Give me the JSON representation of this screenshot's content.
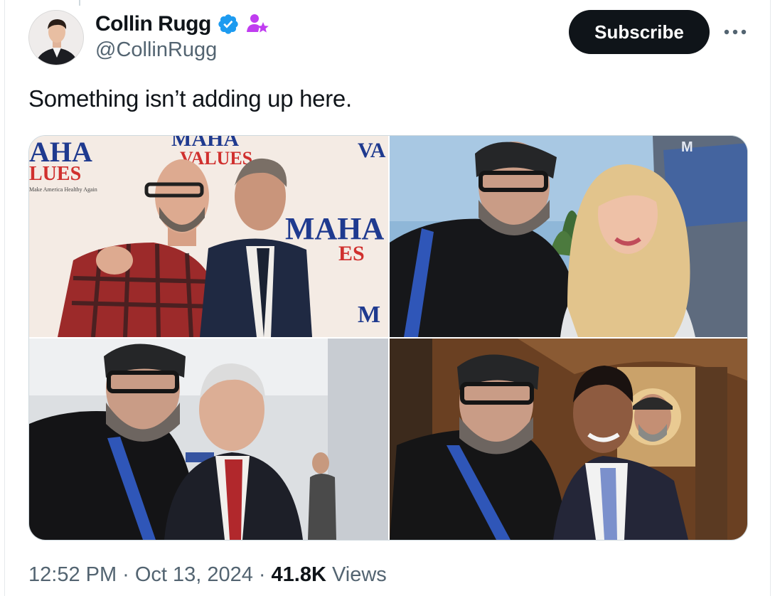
{
  "author": {
    "display_name": "Collin Rugg",
    "handle": "@CollinRugg",
    "verified_icon": "verified-badge-icon",
    "affiliation_icon": "subscriber-star-icon"
  },
  "actions": {
    "subscribe_label": "Subscribe",
    "more_icon": "more-horizontal-icon"
  },
  "tweet": {
    "text": "Something isn’t adding up here."
  },
  "media": {
    "photos": [
      {
        "name": "photo-maha-event",
        "backdrop_text": [
          "AHA",
          "LUES",
          "Make America Healthy Again",
          "MAHA",
          "VALUES",
          "MAHA",
          "ES",
          "VA",
          "M"
        ]
      },
      {
        "name": "photo-selfie-blonde-woman",
        "backdrop_text": [
          "M"
        ]
      },
      {
        "name": "photo-selfie-older-man",
        "backdrop_text": []
      },
      {
        "name": "photo-selfie-man-blue-tie",
        "backdrop_text": []
      }
    ]
  },
  "meta": {
    "time": "12:52 PM",
    "sep1": "·",
    "date": "Oct 13, 2024",
    "sep2": "·",
    "views_count": "41.8K",
    "views_label": "Views"
  },
  "colors": {
    "verified": "#1d9bf0",
    "affiliation": "#c03cf0",
    "subscribe_bg": "#0f1419",
    "secondary_text": "#536471"
  }
}
